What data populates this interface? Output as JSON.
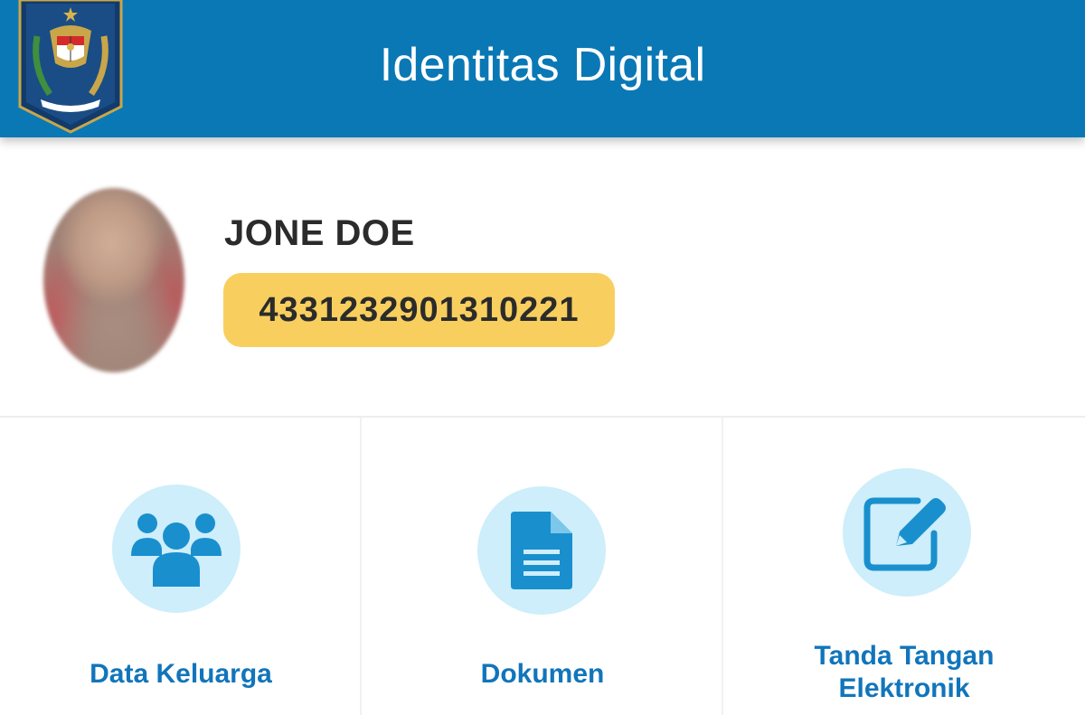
{
  "header": {
    "title": "Identitas Digital",
    "logo_icon": "garuda-emblem-logo"
  },
  "profile": {
    "name": "JONE DOE",
    "nik": "4331232901310221",
    "avatar_icon": "blurred-profile-photo"
  },
  "menu": {
    "items": [
      {
        "label": "Data Keluarga",
        "icon": "family-group-icon"
      },
      {
        "label": "Dokumen",
        "icon": "document-icon"
      },
      {
        "label_line1": "Tanda Tangan",
        "label_line2": "Elektronik",
        "icon": "edit-signature-icon"
      }
    ]
  },
  "colors": {
    "header_bg": "#0a78b5",
    "badge_bg": "#f8cf5e",
    "menu_circle_bg": "#cdeefa",
    "menu_text": "#1175bb",
    "icon_blue": "#1a8fce"
  }
}
